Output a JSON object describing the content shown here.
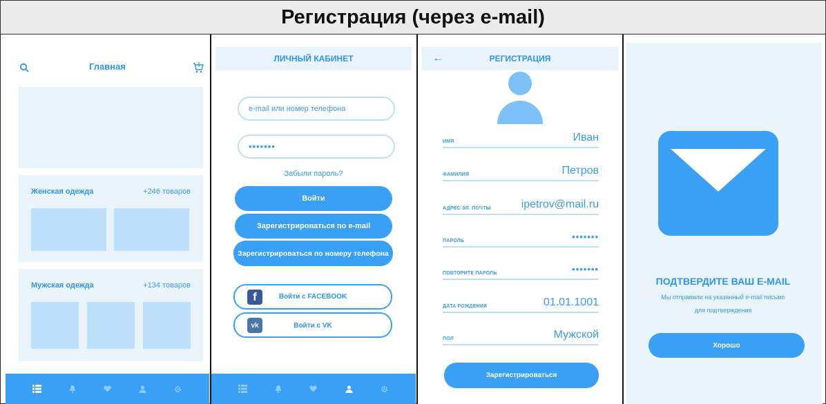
{
  "page_title": "Регистрация (через e-mail)",
  "screen_home": {
    "title": "Главная",
    "sections": [
      {
        "label": "Женская одежда",
        "count": "+246 товаров"
      },
      {
        "label": "Мужская одежда",
        "count": "+134 товаров"
      }
    ]
  },
  "screen_login": {
    "title": "ЛИЧНЫЙ КАБИНЕТ",
    "email_placeholder": "e-mail или номер телефона",
    "password_value": "•••••••",
    "forgot_label": "Забыли пароль?",
    "login_button": "Войти",
    "register_email_button": "Зарегистрироваться по e-mail",
    "register_phone_button": "Зарегистрироваться по номеру телефона",
    "facebook_button": "Войти с FACEBOOK",
    "vk_button": "Войти с VK"
  },
  "screen_register": {
    "title": "РЕГИСТРАЦИЯ",
    "fields": [
      {
        "label": "имя",
        "value": "Иван"
      },
      {
        "label": "фамилия",
        "value": "Петров"
      },
      {
        "label": "адрес эл. почты",
        "value": "ipetrov@mail.ru"
      },
      {
        "label": "пароль",
        "value": "•••••••"
      },
      {
        "label": "повторите пароль",
        "value": "•••••••"
      },
      {
        "label": "дата рождения",
        "value": "01.01.1001"
      },
      {
        "label": "пол",
        "value": "Мужской"
      }
    ],
    "submit_button": "Зарегистрироваться"
  },
  "screen_confirm": {
    "title": "ПОДТВЕРДИТЕ ВАШ E-MAIL",
    "text": "Мы отправили на указанный e-mail письмо для подтверждения",
    "ok_button": "Хорошо"
  },
  "colors": {
    "accent": "#3aa0f5",
    "light_bg": "#eaf4fd",
    "tile": "#bfe0fb",
    "avatar": "#7ec0f8"
  },
  "tabbar_icons": [
    "catalog-icon",
    "bell-icon",
    "heart-icon",
    "user-icon",
    "gear-icon"
  ]
}
